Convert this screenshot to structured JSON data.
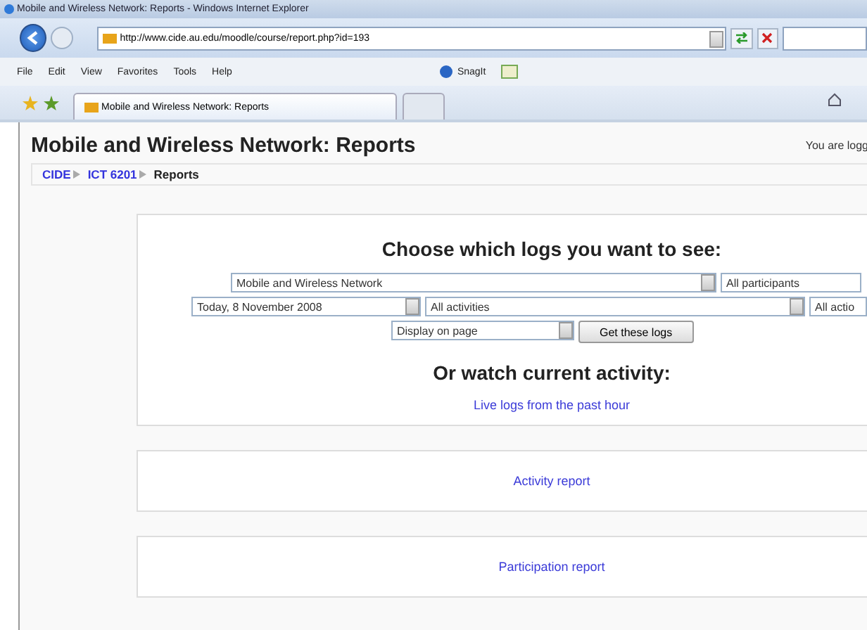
{
  "window": {
    "title": "Mobile and Wireless Network: Reports - Windows Internet Explorer"
  },
  "address_bar": {
    "url": "http://www.cide.au.edu/moodle/course/report.php?id=193"
  },
  "menu": [
    "File",
    "Edit",
    "View",
    "Favorites",
    "Tools",
    "Help"
  ],
  "toolbar": {
    "snagit": "SnagIt"
  },
  "tabs": [
    {
      "label": "Mobile and Wireless Network: Reports",
      "selected": true
    },
    {
      "selected": false
    }
  ],
  "page": {
    "title": "Mobile and Wireless Network: Reports",
    "login": "You are logg",
    "breadcrumb": [
      {
        "label": "CIDE",
        "link": true
      },
      {
        "label": "ICT 6201",
        "link": true
      },
      {
        "label": "Reports",
        "link": false
      }
    ]
  },
  "logs": {
    "heading": "Choose which logs you want to see:",
    "row1": [
      "Mobile and Wireless Network",
      "All participants"
    ],
    "row2": [
      "Today, 8 November 2008",
      "All activities",
      "All actio"
    ],
    "display": "Display on page",
    "button": "Get these logs",
    "current_heading": "Or watch current activity:",
    "live_link": "Live logs from the past hour"
  },
  "reports": [
    "Activity report",
    "Participation report"
  ]
}
